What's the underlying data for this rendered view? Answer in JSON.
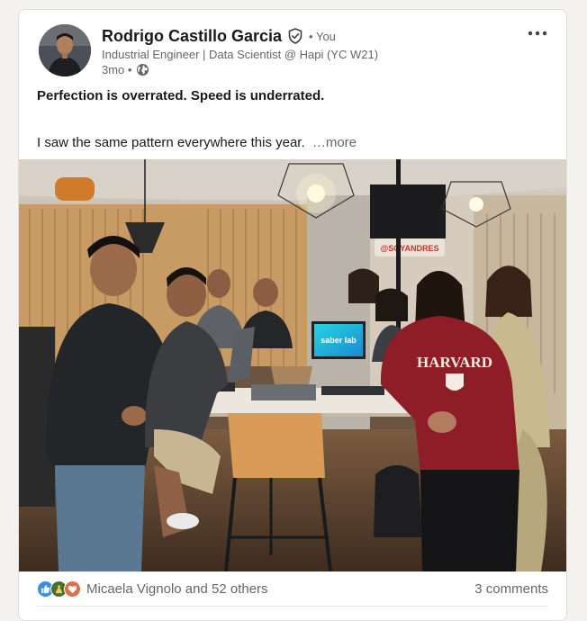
{
  "post": {
    "author": {
      "name": "Rodrigo Castillo Garcia",
      "relation": "• You",
      "headline": "Industrial Engineer | Data Scientist @ Hapi (YC W21)",
      "time": "3mo •"
    },
    "text": {
      "bold": "Perfection is overrated. Speed is underrated.",
      "body": "I saw the same pattern everywhere this year.",
      "see_more": "…more"
    },
    "image": {
      "laptop_screen": "saber lab",
      "sweatshirt": "HARVARD",
      "wall_sign": "@SOYANDRES"
    },
    "social": {
      "reactors": "Micaela Vignolo and 52 others",
      "comments": "3 comments"
    },
    "colors": {
      "like": "#378fe9",
      "celebrate": "#44712e",
      "love": "#df704d"
    },
    "icons": [
      "verified-shield-icon",
      "globe-icon",
      "more-options-icon",
      "like-reaction-icon",
      "celebrate-reaction-icon",
      "love-reaction-icon"
    ]
  }
}
